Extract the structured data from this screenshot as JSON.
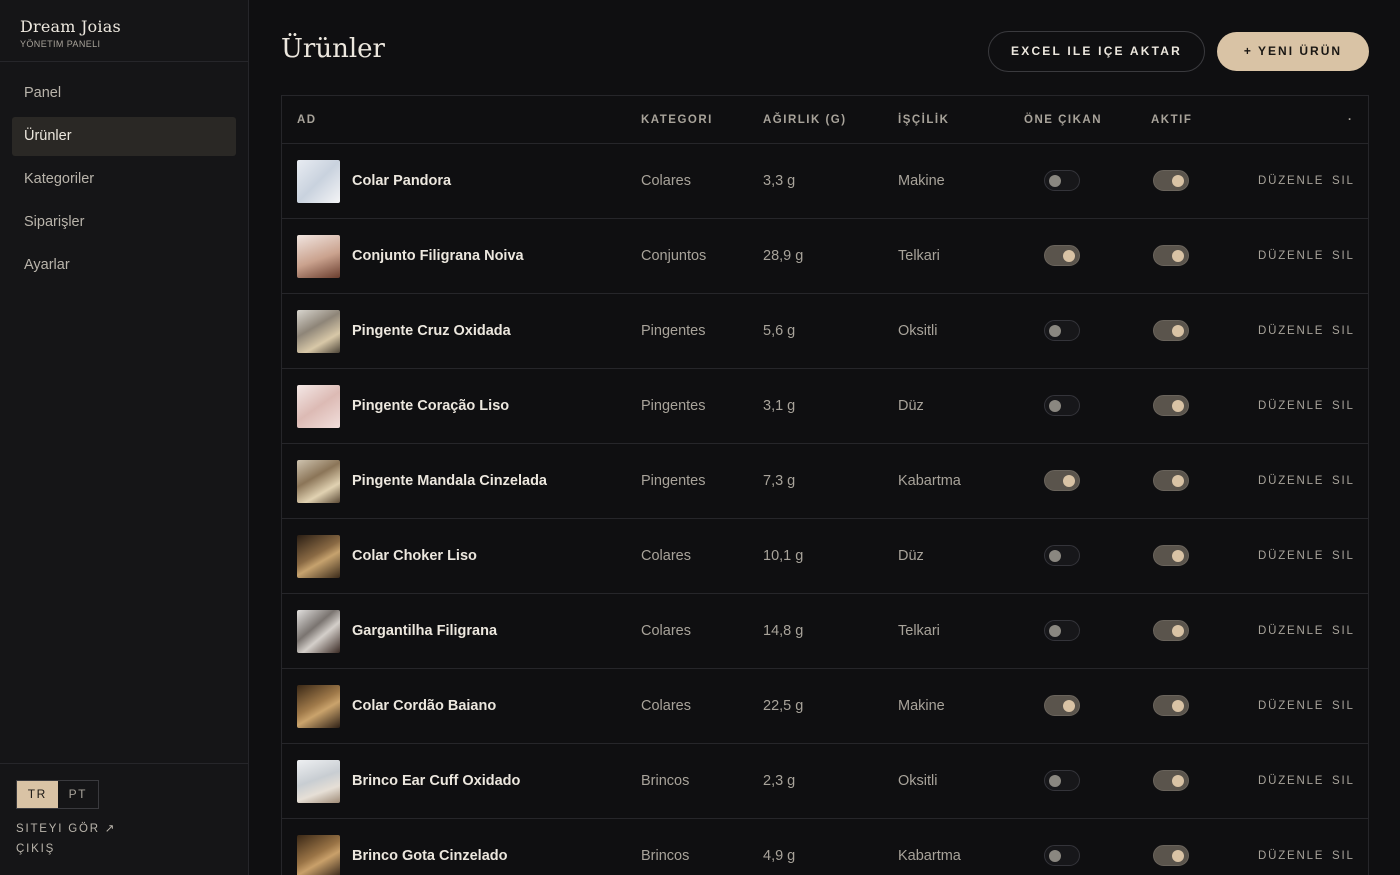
{
  "brand": {
    "name": "Dream Joias",
    "subtitle": "YÖNETIM PANELI"
  },
  "nav": [
    {
      "label": "Panel"
    },
    {
      "label": "Ürünler"
    },
    {
      "label": "Kategoriler"
    },
    {
      "label": "Siparişler"
    },
    {
      "label": "Ayarlar"
    }
  ],
  "lang": {
    "tr": "TR",
    "pt": "PT",
    "selected": "TR"
  },
  "side_links": {
    "view_site": "SITEYI GÖR ↗",
    "logout": "ÇIKIŞ"
  },
  "page": {
    "title": "Ürünler",
    "import_label": "EXCEL ILE IÇE AKTAR",
    "new_label": "+ YENI ÜRÜN"
  },
  "table": {
    "headers": {
      "name": "AD",
      "category": "KATEGORI",
      "weight": "AĞIRLIK (G)",
      "craft": "İŞÇİLİK",
      "featured": "ÖNE ÇIKAN",
      "active": "AKTIF",
      "actions": "·"
    },
    "edit_label": "DÜZENLE",
    "delete_label": "SIL",
    "rows": [
      {
        "name": "Colar Pandora",
        "category": "Colares",
        "weight": "3,3 g",
        "craft": "Makine",
        "featured": false,
        "active": true
      },
      {
        "name": "Conjunto Filigrana Noiva",
        "category": "Conjuntos",
        "weight": "28,9 g",
        "craft": "Telkari",
        "featured": true,
        "active": true
      },
      {
        "name": "Pingente Cruz Oxidada",
        "category": "Pingentes",
        "weight": "5,6 g",
        "craft": "Oksitli",
        "featured": false,
        "active": true
      },
      {
        "name": "Pingente Coração Liso",
        "category": "Pingentes",
        "weight": "3,1 g",
        "craft": "Düz",
        "featured": false,
        "active": true
      },
      {
        "name": "Pingente Mandala Cinzelada",
        "category": "Pingentes",
        "weight": "7,3 g",
        "craft": "Kabartma",
        "featured": true,
        "active": true
      },
      {
        "name": "Colar Choker Liso",
        "category": "Colares",
        "weight": "10,1 g",
        "craft": "Düz",
        "featured": false,
        "active": true
      },
      {
        "name": "Gargantilha Filigrana",
        "category": "Colares",
        "weight": "14,8 g",
        "craft": "Telkari",
        "featured": false,
        "active": true
      },
      {
        "name": "Colar Cordão Baiano",
        "category": "Colares",
        "weight": "22,5 g",
        "craft": "Makine",
        "featured": true,
        "active": true
      },
      {
        "name": "Brinco Ear Cuff Oxidado",
        "category": "Brincos",
        "weight": "2,3 g",
        "craft": "Oksitli",
        "featured": false,
        "active": true
      },
      {
        "name": "Brinco Gota Cinzelado",
        "category": "Brincos",
        "weight": "4,9 g",
        "craft": "Kabartma",
        "featured": false,
        "active": true
      }
    ]
  }
}
